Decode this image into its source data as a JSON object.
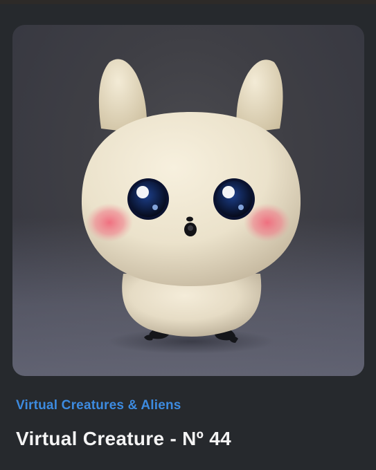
{
  "nft": {
    "image_alt": "Virtual Creature - Nº 44",
    "collection_name": "Virtual Creatures & Aliens",
    "title": "Virtual Creature - Nº 44"
  },
  "colors": {
    "background": "#26292d",
    "collection_link": "#3d8be0",
    "title": "#f4f4f4"
  }
}
